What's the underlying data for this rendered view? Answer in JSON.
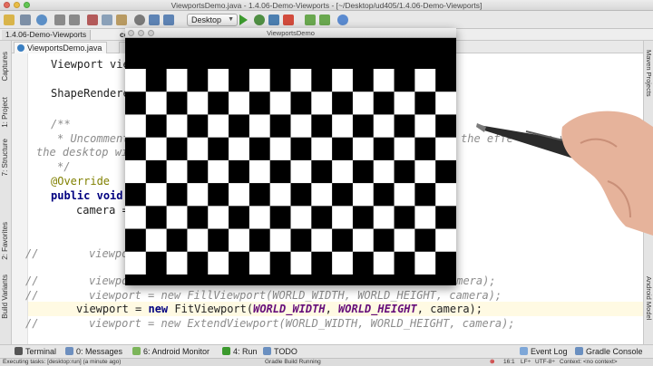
{
  "window": {
    "title": "ViewportsDemo.java - 1.4.06-Demo-Viewports - [~/Desktop/ud405/1.4.06-Demo-Viewports]"
  },
  "toolbar": {
    "run_config": "Desktop"
  },
  "navbar": {
    "project": "1.4.06-Demo-Viewports",
    "module": "co"
  },
  "left_tools": {
    "captures": "Captures",
    "project": "1: Project",
    "structure": "7: Structure",
    "favorites": "2: Favorites",
    "build_variants": "Build Variants"
  },
  "right_tools": {
    "gradle": "Maven Projects",
    "model": "Android Model"
  },
  "editor": {
    "tab_active": "ViewportsDemo.java",
    "tab_second": "co",
    "lines": {
      "l1": "Viewport vie",
      "l2": "ShapeRendere",
      "l3a": "/**",
      "l3b": "* Uncomment",
      "l3c": "the effe",
      "l3d": "en you resize",
      "l3e": "the desktop wi",
      "l3f": "*/",
      "l4": "@Override",
      "l5a": "public",
      "l5b": "void",
      "l6": "camera =",
      "l7a": "//",
      "l7b": "viewpo",
      "l8a": "//",
      "l8b": "viewpo",
      "l8c": "amera);",
      "l9a": "//",
      "l9b": "viewport = new FillViewport(WORLD_WIDTH, WORLD_HEIGHT, camera);",
      "l10a": "viewport",
      "l10b": "new",
      "l10c": "FitViewport(",
      "l10d": "WORLD_WIDTH",
      "l10e": "WORLD_HEIGHT",
      "l10f": "camera);",
      "l11a": "//",
      "l11b": "viewport = new ExtendViewport(WORLD_WIDTH, WORLD_HEIGHT, camera);"
    }
  },
  "game_window": {
    "title": "ViewportsDemo",
    "rows": 9,
    "cols": 16
  },
  "bottom_tabs": {
    "terminal": "Terminal",
    "messages": "0: Messages",
    "monitor": "6: Android Monitor",
    "run": "4: Run",
    "todo": "TODO",
    "event_log": "Event Log",
    "gradle_console": "Gradle Console"
  },
  "status": {
    "task": "Executing tasks: [desktop:run] (a minute ago)",
    "gradle": "Gradle Build Running",
    "position": "16:1",
    "line_sep": "LF÷",
    "encoding": "UTF-8÷",
    "context": "Context: <no context>"
  }
}
